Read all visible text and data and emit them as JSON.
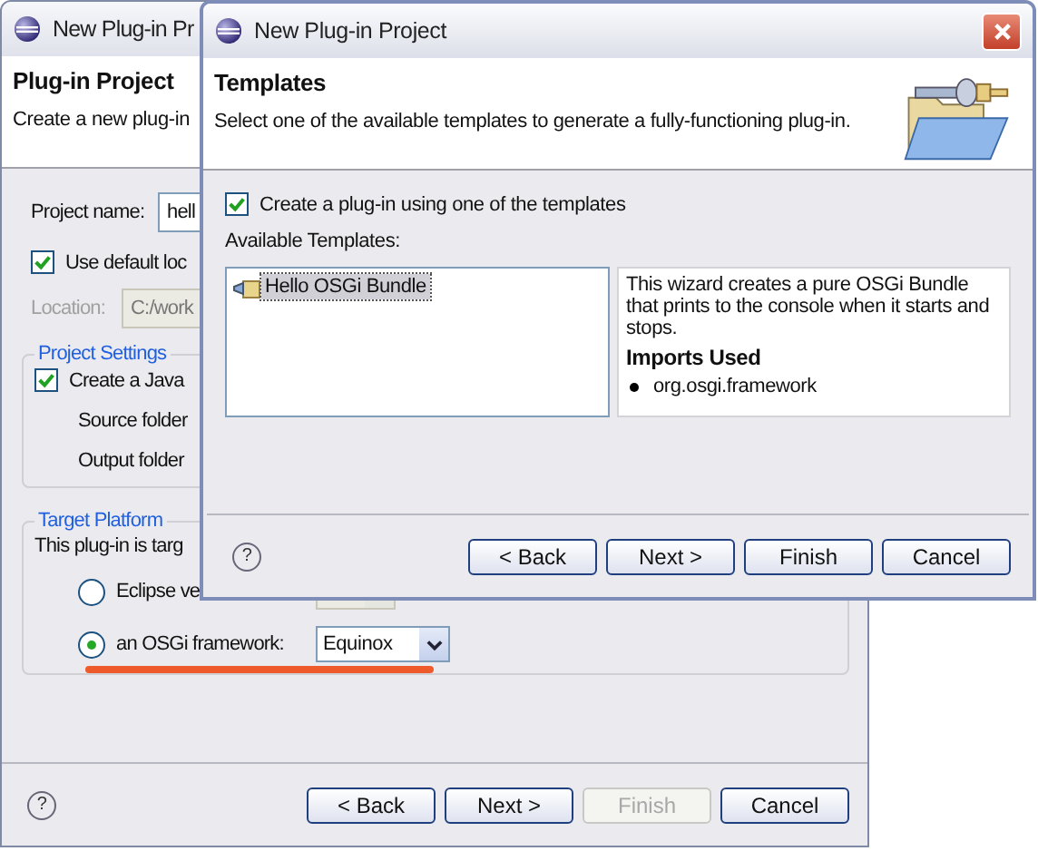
{
  "back_window": {
    "title": "New Plug-in Pr",
    "heading": "Plug-in Project",
    "description": "Create a new plug-in",
    "project_name": {
      "label": "Project name:",
      "value": "hell"
    },
    "use_default_location": {
      "label": "Use default loc",
      "checked": true
    },
    "location": {
      "label": "Location:",
      "value": "C:/work",
      "disabled": true
    },
    "project_settings": {
      "title": "Project Settings",
      "create_java": {
        "label": "Create a Java",
        "checked": true
      },
      "source_folder_label": "Source folder",
      "output_folder_label": "Output folder"
    },
    "target_platform": {
      "title": "Target Platform",
      "intro": "This plug-in is targ",
      "options": [
        {
          "label": "Eclipse ve",
          "selected": false,
          "combo_disabled": true
        },
        {
          "label": "an OSGi framework:",
          "selected": true,
          "value": "Equinox"
        }
      ]
    },
    "help": "?",
    "buttons": [
      {
        "label": "< Back",
        "disabled": false
      },
      {
        "label": "Next >",
        "disabled": false
      },
      {
        "label": "Finish",
        "disabled": true
      },
      {
        "label": "Cancel",
        "disabled": false
      }
    ]
  },
  "front_window": {
    "title": "New Plug-in Project",
    "heading": "Templates",
    "description": "Select one of the available templates to generate a fully-functioning plug-in.",
    "use_template": {
      "label": "Create a plug-in using one of the templates",
      "checked": true
    },
    "templates_label": "Available Templates:",
    "templates": [
      {
        "label": "Hello OSGi Bundle",
        "selected": true
      }
    ],
    "template_description": "This wizard creates a pure OSGi Bundle that prints to the console when it starts and stops.",
    "imports_heading": "Imports Used",
    "imports": [
      "org.osgi.framework"
    ],
    "help": "?",
    "buttons": [
      {
        "label": "< Back",
        "disabled": false
      },
      {
        "label": "Next >",
        "disabled": false
      },
      {
        "label": "Finish",
        "disabled": false
      },
      {
        "label": "Cancel",
        "disabled": false
      }
    ]
  }
}
